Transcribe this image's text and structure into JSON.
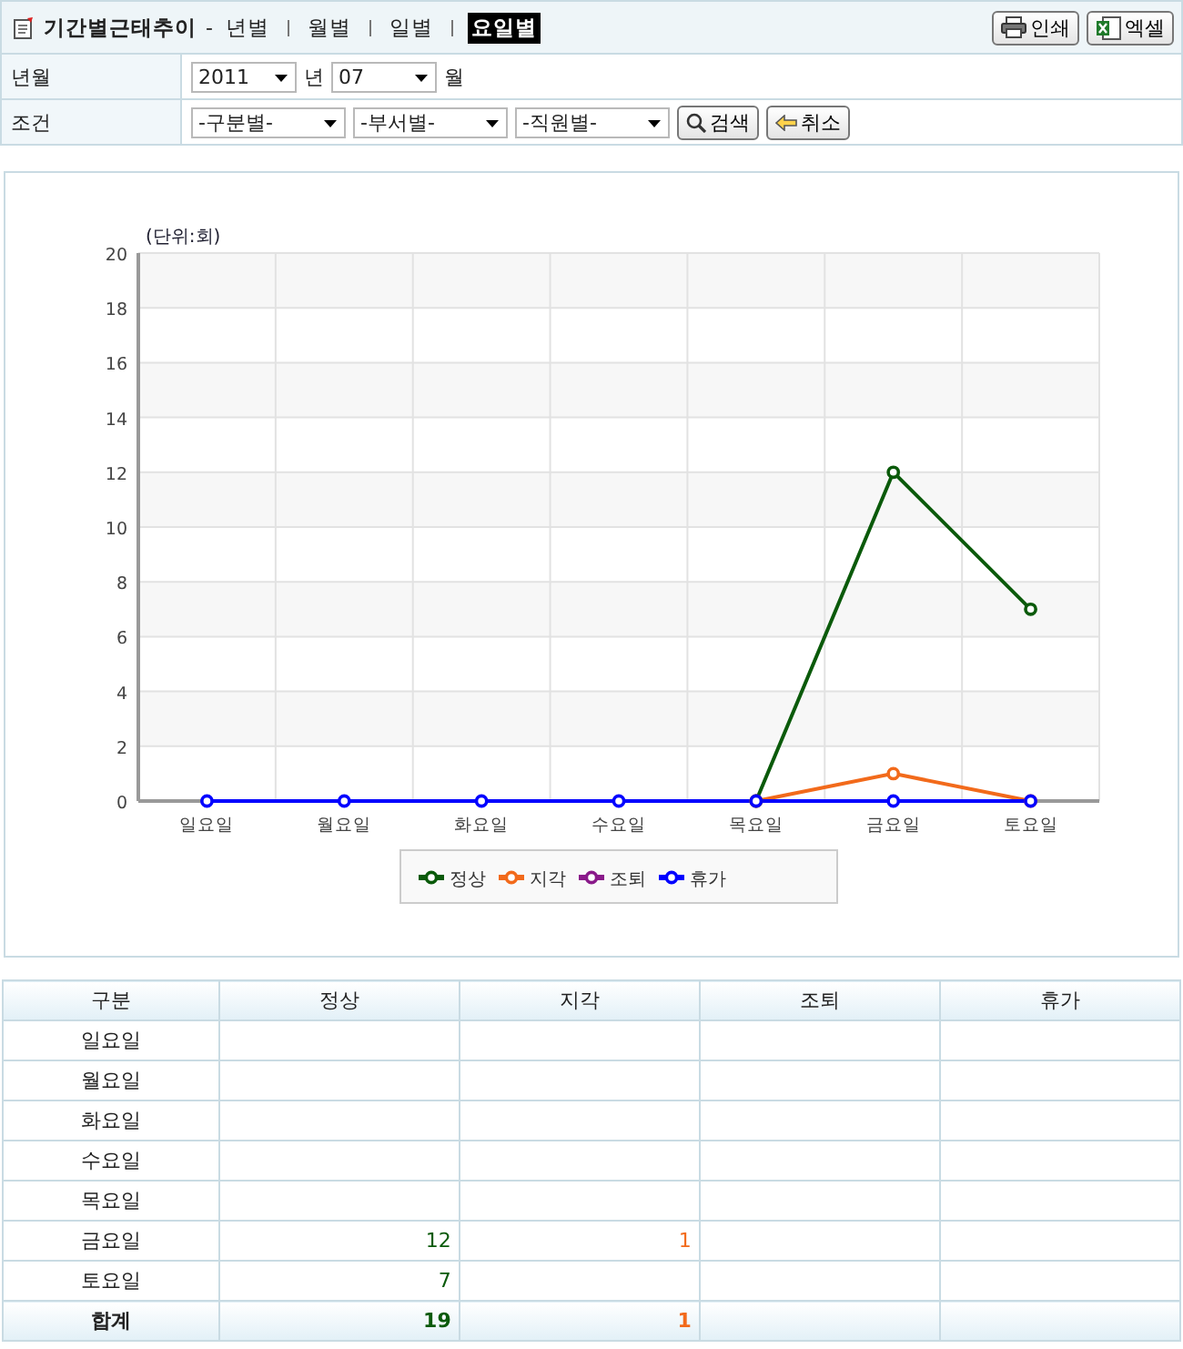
{
  "header": {
    "title": "기간별근태추이",
    "separator": "-",
    "tabs": [
      {
        "label": "년별",
        "selected": false
      },
      {
        "label": "월별",
        "selected": false
      },
      {
        "label": "일별",
        "selected": false
      },
      {
        "label": "요일별",
        "selected": true
      }
    ],
    "buttons": [
      {
        "label": "인쇄",
        "kind": "print"
      },
      {
        "label": "엑셀",
        "kind": "excel"
      }
    ]
  },
  "form": {
    "rows": [
      {
        "label": "년월",
        "controls": [
          {
            "kind": "select",
            "value": "2011"
          },
          {
            "kind": "text",
            "value": "년"
          },
          {
            "kind": "select",
            "value": "07"
          },
          {
            "kind": "text",
            "value": "월"
          }
        ]
      },
      {
        "label": "조건",
        "controls": [
          {
            "kind": "select",
            "value": "-구분별-"
          },
          {
            "kind": "select",
            "value": "-부서별-"
          },
          {
            "kind": "select",
            "value": "-직원별-"
          },
          {
            "kind": "search",
            "value": "검색"
          },
          {
            "kind": "cancel",
            "value": "취소"
          }
        ]
      }
    ]
  },
  "chart": {
    "chart_data": {
      "type": "line",
      "ylabel": "(단위:회)",
      "categories": [
        "일요일",
        "월요일",
        "화요일",
        "수요일",
        "목요일",
        "금요일",
        "토요일"
      ],
      "ylim": [
        0,
        20
      ],
      "yticks": [
        0,
        2,
        4,
        6,
        8,
        10,
        12,
        14,
        16,
        18,
        20
      ],
      "grid": true,
      "legend": "bottom",
      "series": [
        {
          "name": "정상",
          "color": "#0a5a0a",
          "marker": true,
          "values": [
            null,
            null,
            null,
            null,
            0,
            12,
            7
          ]
        },
        {
          "name": "지각",
          "color": "#f26a1b",
          "marker": true,
          "values": [
            null,
            null,
            null,
            null,
            0,
            1,
            0
          ]
        },
        {
          "name": "조퇴",
          "color": "#8a1a8a",
          "marker": true,
          "values": [
            null,
            null,
            null,
            null,
            null,
            null,
            null
          ]
        },
        {
          "name": "휴가",
          "color": "#0000ff",
          "marker": true,
          "values": [
            0,
            0,
            0,
            0,
            0,
            0,
            0
          ]
        }
      ]
    }
  },
  "table": {
    "columns": [
      "구분",
      "정상",
      "지각",
      "조퇴",
      "휴가"
    ],
    "rows": [
      {
        "kind": "day",
        "cells": [
          "일요일",
          "",
          "",
          "",
          ""
        ]
      },
      {
        "kind": "day",
        "cells": [
          "월요일",
          "",
          "",
          "",
          ""
        ]
      },
      {
        "kind": "day",
        "cells": [
          "화요일",
          "",
          "",
          "",
          ""
        ]
      },
      {
        "kind": "day",
        "cells": [
          "수요일",
          "",
          "",
          "",
          ""
        ]
      },
      {
        "kind": "day",
        "cells": [
          "목요일",
          "",
          "",
          "",
          ""
        ]
      },
      {
        "kind": "day",
        "cells": [
          "금요일",
          "12",
          "1",
          "",
          ""
        ]
      },
      {
        "kind": "day",
        "cells": [
          "토요일",
          "7",
          "",
          "",
          ""
        ]
      },
      {
        "kind": "total",
        "cells": [
          "합계",
          "19",
          "1",
          "",
          ""
        ]
      }
    ]
  }
}
